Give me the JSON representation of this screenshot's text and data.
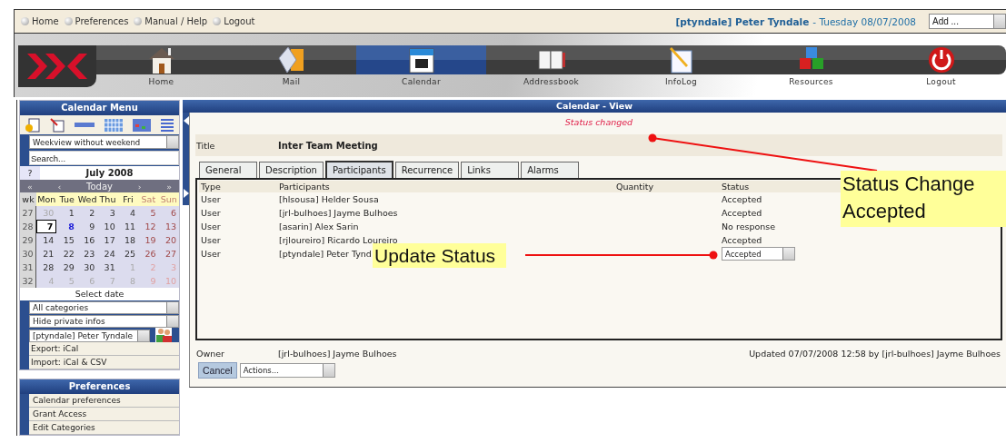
{
  "top_links": [
    "Home",
    "Preferences",
    "Manual / Help",
    "Logout"
  ],
  "user": {
    "account": "[ptyndale] Peter Tyndale",
    "date": "- Tuesday 08/07/2008"
  },
  "add_select": {
    "value": "Add ..."
  },
  "nav": [
    {
      "label": "Home",
      "selected": false
    },
    {
      "label": "Mail",
      "selected": false
    },
    {
      "label": "Calendar",
      "selected": true
    },
    {
      "label": "Addressbook",
      "selected": false
    },
    {
      "label": "InfoLog",
      "selected": false
    },
    {
      "label": "Resources",
      "selected": false
    },
    {
      "label": "Logout",
      "selected": false
    }
  ],
  "calendar_menu": {
    "title": "Calendar Menu",
    "view_select": "Weekview without weekend",
    "search_placeholder": "Search...",
    "help": "?",
    "month": "July 2008",
    "nav_buttons": [
      "«",
      "‹",
      "Today",
      "›",
      "»"
    ],
    "wk_label": "wk",
    "weekdays": [
      {
        "label": "Mon",
        "weekend": false
      },
      {
        "label": "Tue",
        "weekend": false
      },
      {
        "label": "Wed",
        "weekend": false
      },
      {
        "label": "Thu",
        "weekend": false
      },
      {
        "label": "Fri",
        "weekend": false
      },
      {
        "label": "Sat",
        "weekend": true
      },
      {
        "label": "Sun",
        "weekend": true
      }
    ],
    "weeks": [
      {
        "wk": "27",
        "days": [
          {
            "label": "30",
            "kind": "other"
          },
          {
            "label": "1",
            "kind": "day"
          },
          {
            "label": "2",
            "kind": "day"
          },
          {
            "label": "3",
            "kind": "day"
          },
          {
            "label": "4",
            "kind": "day"
          },
          {
            "label": "5",
            "kind": "weekend"
          },
          {
            "label": "6",
            "kind": "weekend"
          }
        ]
      },
      {
        "wk": "28",
        "days": [
          {
            "label": "7",
            "kind": "today"
          },
          {
            "label": "8",
            "kind": "marked"
          },
          {
            "label": "9",
            "kind": "day"
          },
          {
            "label": "10",
            "kind": "day"
          },
          {
            "label": "11",
            "kind": "day"
          },
          {
            "label": "12",
            "kind": "weekend"
          },
          {
            "label": "13",
            "kind": "weekend"
          }
        ]
      },
      {
        "wk": "29",
        "days": [
          {
            "label": "14",
            "kind": "day"
          },
          {
            "label": "15",
            "kind": "day"
          },
          {
            "label": "16",
            "kind": "day"
          },
          {
            "label": "17",
            "kind": "day"
          },
          {
            "label": "18",
            "kind": "day"
          },
          {
            "label": "19",
            "kind": "weekend"
          },
          {
            "label": "20",
            "kind": "weekend"
          }
        ]
      },
      {
        "wk": "30",
        "days": [
          {
            "label": "21",
            "kind": "day"
          },
          {
            "label": "22",
            "kind": "day"
          },
          {
            "label": "23",
            "kind": "day"
          },
          {
            "label": "24",
            "kind": "day"
          },
          {
            "label": "25",
            "kind": "day"
          },
          {
            "label": "26",
            "kind": "weekend"
          },
          {
            "label": "27",
            "kind": "weekend"
          }
        ]
      },
      {
        "wk": "31",
        "days": [
          {
            "label": "28",
            "kind": "day"
          },
          {
            "label": "29",
            "kind": "day"
          },
          {
            "label": "30",
            "kind": "day"
          },
          {
            "label": "31",
            "kind": "day"
          },
          {
            "label": "1",
            "kind": "other"
          },
          {
            "label": "2",
            "kind": "other_weekend"
          },
          {
            "label": "3",
            "kind": "other_weekend"
          }
        ]
      },
      {
        "wk": "32",
        "days": [
          {
            "label": "4",
            "kind": "other"
          },
          {
            "label": "5",
            "kind": "other"
          },
          {
            "label": "6",
            "kind": "other"
          },
          {
            "label": "7",
            "kind": "other"
          },
          {
            "label": "8",
            "kind": "other"
          },
          {
            "label": "9",
            "kind": "other_weekend"
          },
          {
            "label": "10",
            "kind": "other_weekend"
          }
        ]
      }
    ],
    "select_date": "Select date",
    "selects": [
      "All categories",
      "Hide private infos"
    ],
    "user_select": "[ptyndale] Peter Tyndale",
    "export": "Export: iCal",
    "import": "Import: iCal & CSV"
  },
  "preferences": {
    "title": "Preferences",
    "items": [
      "Calendar preferences",
      "Grant Access",
      "Edit Categories"
    ]
  },
  "panel": {
    "title": "Calendar - View",
    "message": "Status changed",
    "title_label": "Title",
    "title_value": "Inter Team Meeting",
    "tabs": [
      {
        "label": "General",
        "selected": false
      },
      {
        "label": "Description",
        "selected": false
      },
      {
        "label": "Participants",
        "selected": true
      },
      {
        "label": "Recurrence",
        "selected": false
      },
      {
        "label": "Links",
        "selected": false
      },
      {
        "label": "Alarms",
        "selected": false
      }
    ],
    "columns": [
      "Type",
      "Participants",
      "Quantity",
      "Status"
    ],
    "rows": [
      {
        "type": "User",
        "participant": "[hlsousa] Helder Sousa",
        "status": "Accepted",
        "kind": "text"
      },
      {
        "type": "User",
        "participant": "[jrl-bulhoes] Jayme Bulhoes",
        "status": "Accepted",
        "kind": "text"
      },
      {
        "type": "User",
        "participant": "[asarin] Alex Sarin",
        "status": "No response",
        "kind": "text"
      },
      {
        "type": "User",
        "participant": "[rjloureiro] Ricardo Loureiro",
        "status": "Accepted",
        "kind": "text"
      },
      {
        "type": "User",
        "participant": "[ptyndale] Peter Tynd",
        "status": "Accepted",
        "kind": "select"
      }
    ],
    "owner_label": "Owner",
    "owner_value": "[jrl-bulhoes] Jayme Bulhoes",
    "updated": "Updated 07/07/2008 12:58 by [jrl-bulhoes] Jayme Bulhoes",
    "cancel": "Cancel",
    "actions": "Actions..."
  },
  "annotations": [
    {
      "text": "Status Change Accepted"
    },
    {
      "text": "Update Status"
    }
  ]
}
